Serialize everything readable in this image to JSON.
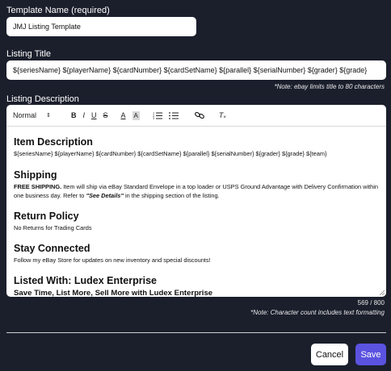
{
  "template_name": {
    "label": "Template Name (required)",
    "value": "JMJ Listing Template"
  },
  "listing_title": {
    "label": "Listing Title",
    "value": "${seriesName} ${playerName} ${cardNumber} ${cardSetName} ${parallel} ${serialNumber} ${grader} ${grade}",
    "note": "*Note: ebay limits title to 80 characters"
  },
  "listing_description": {
    "label": "Listing Description",
    "toolbar": {
      "style_select": "Normal",
      "bold": "B",
      "italic": "I",
      "underline": "U",
      "strike": "S",
      "font_color": "A",
      "highlight": "A",
      "clear": "T"
    },
    "content": {
      "item_heading": "Item Description",
      "item_text": "${seriesName} ${playerName} ${cardNumber} ${cardSetName} ${parallel} ${serialNumber} ${grader} ${grade} ${team}",
      "shipping_heading": "Shipping",
      "shipping_bold": "FREE SHIPPING.",
      "shipping_text": " Item will ship via eBay Standard Envelope in a top loader or USPS Ground Advantage with Delivery Confirmation within one business day. Refer to ",
      "shipping_emph": "\"See Details\"",
      "shipping_tail": " in the shipping section of the listing.",
      "return_heading": "Return Policy",
      "return_text": "No Returns for Trading Cards",
      "stay_heading": "Stay Connected",
      "stay_text": "Follow my eBay Store for updates on new inventory and special discounts!",
      "listed_heading": "Listed With: Ludex Enterprise",
      "listed_text": "Save Time, List More, Sell More with Ludex Enterprise"
    },
    "counter": "569 / 800",
    "note": "*Note: Character count includes text formatting"
  },
  "actions": {
    "cancel": "Cancel",
    "save": "Save"
  },
  "colors": {
    "background": "#1b1f2c",
    "save_button": "#5b53e0"
  }
}
